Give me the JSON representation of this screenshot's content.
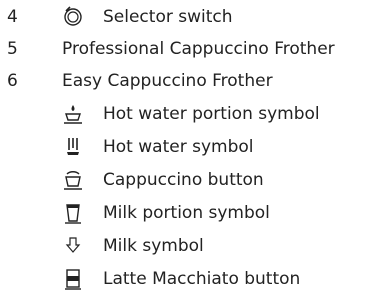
{
  "items": [
    {
      "number": "4",
      "label": "Selector switch",
      "icon": "selector-switch-icon"
    },
    {
      "number": "5",
      "label": "Professional Cappuccino Frother"
    },
    {
      "number": "6",
      "label": "Easy Cappuccino Frother"
    }
  ],
  "subitems": [
    {
      "label": "Hot water portion symbol",
      "icon": "hot-water-portion-icon"
    },
    {
      "label": "Hot water symbol",
      "icon": "hot-water-icon"
    },
    {
      "label": "Cappuccino button",
      "icon": "cappuccino-icon"
    },
    {
      "label": "Milk portion symbol",
      "icon": "milk-portion-icon"
    },
    {
      "label": "Milk symbol",
      "icon": "milk-icon"
    },
    {
      "label": "Latte Macchiato button",
      "icon": "latte-macchiato-icon"
    }
  ]
}
